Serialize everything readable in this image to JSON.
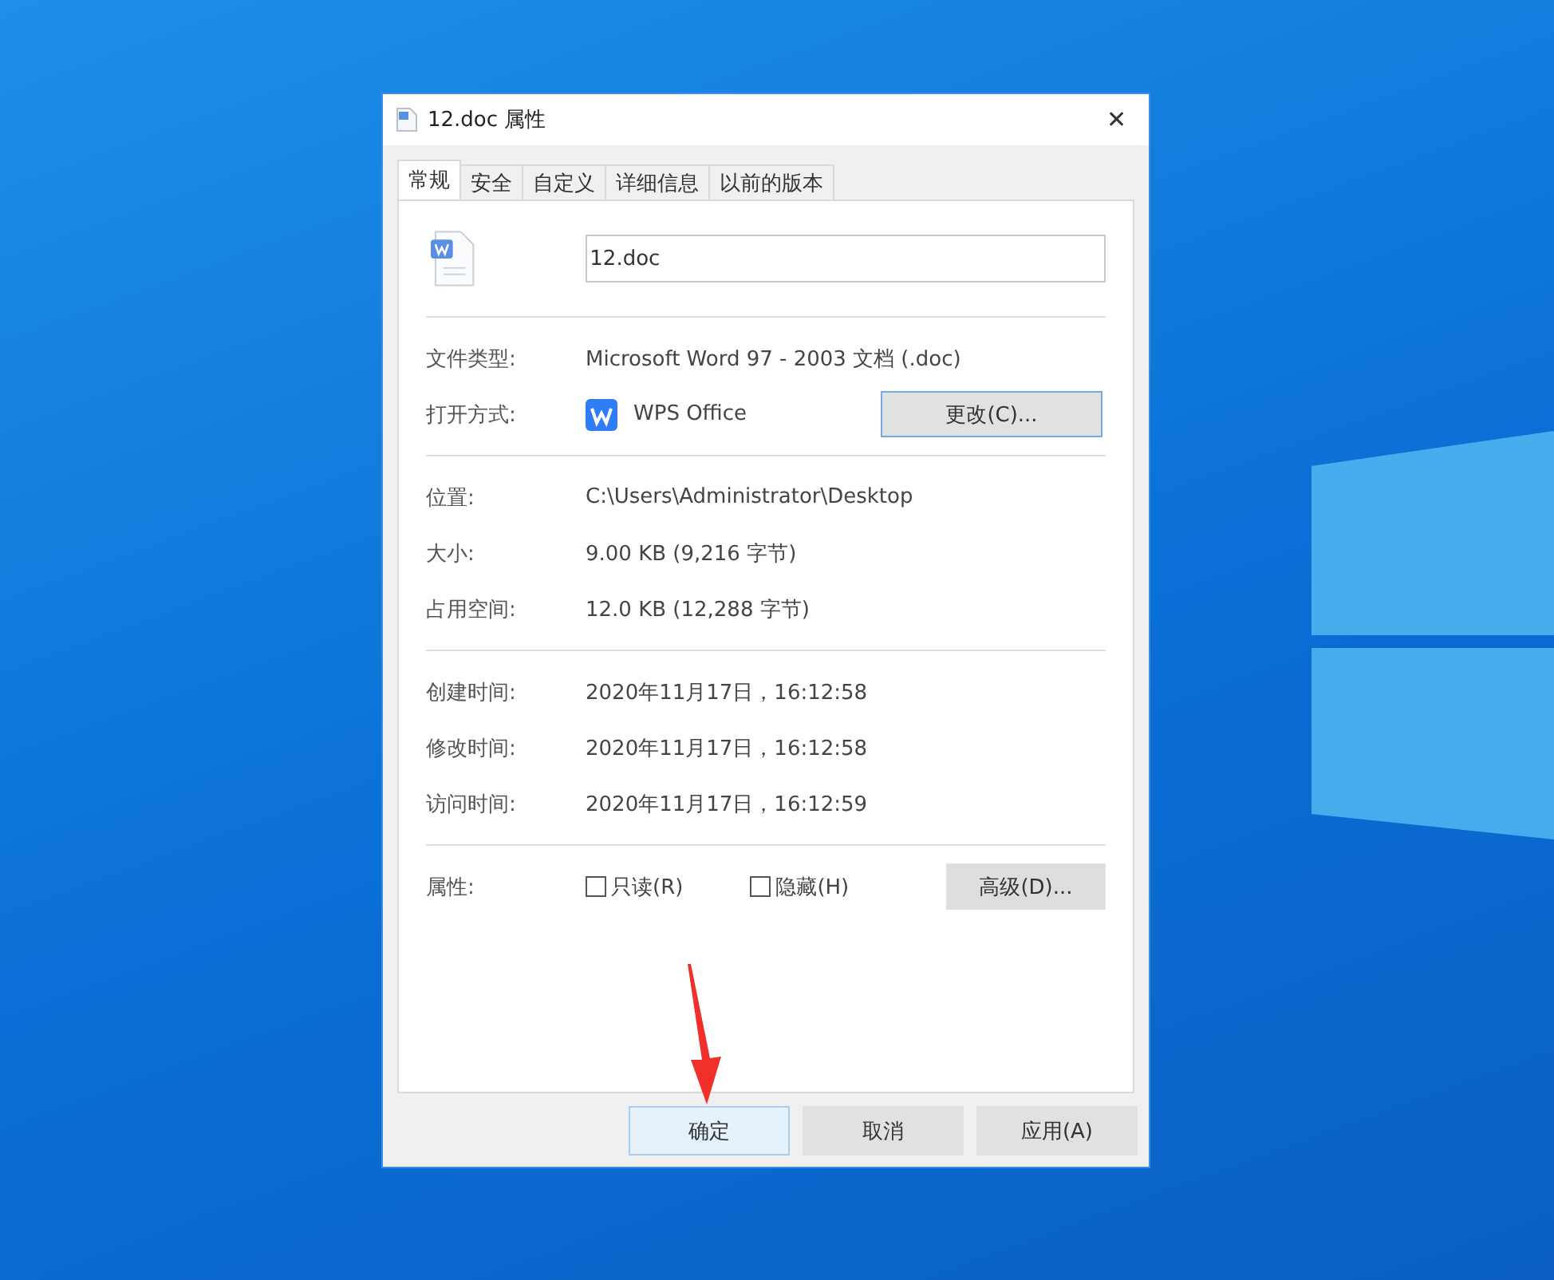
{
  "window": {
    "title": "12.doc 属性",
    "close": "✕"
  },
  "tabs": [
    {
      "label": "常规",
      "selected": true
    },
    {
      "label": "安全",
      "selected": false
    },
    {
      "label": "自定义",
      "selected": false
    },
    {
      "label": "详细信息",
      "selected": false
    },
    {
      "label": "以前的版本",
      "selected": false
    }
  ],
  "file_name": {
    "value": "12.doc"
  },
  "sections": [
    {
      "rows": [
        {
          "kind": "text",
          "label": "文件类型:",
          "value": "Microsoft Word 97 - 2003 文档 (.doc)"
        },
        {
          "kind": "app",
          "label": "打开方式:",
          "value": "WPS Office",
          "button": "更改(C)..."
        }
      ]
    },
    {
      "rows": [
        {
          "kind": "text",
          "label": "位置:",
          "value": "C:\\Users\\Administrator\\Desktop"
        },
        {
          "kind": "text",
          "label": "大小:",
          "value": "9.00 KB (9,216 字节)"
        },
        {
          "kind": "text",
          "label": "占用空间:",
          "value": "12.0 KB (12,288 字节)"
        }
      ]
    },
    {
      "rows": [
        {
          "kind": "text",
          "label": "创建时间:",
          "value": "2020年11月17日，16:12:58"
        },
        {
          "kind": "text",
          "label": "修改时间:",
          "value": "2020年11月17日，16:12:58"
        },
        {
          "kind": "text",
          "label": "访问时间:",
          "value": "2020年11月17日，16:12:59"
        }
      ]
    },
    {
      "rows": [
        {
          "kind": "attributes",
          "label": "属性:",
          "checkboxes": [
            {
              "label": "只读(R)",
              "checked": false
            },
            {
              "label": "隐藏(H)",
              "checked": false
            }
          ],
          "button": "高级(D)..."
        }
      ]
    }
  ],
  "buttons": [
    {
      "label": "确定",
      "hovered": true
    },
    {
      "label": "取消",
      "hovered": false
    },
    {
      "label": "应用(A)",
      "hovered": false
    }
  ]
}
